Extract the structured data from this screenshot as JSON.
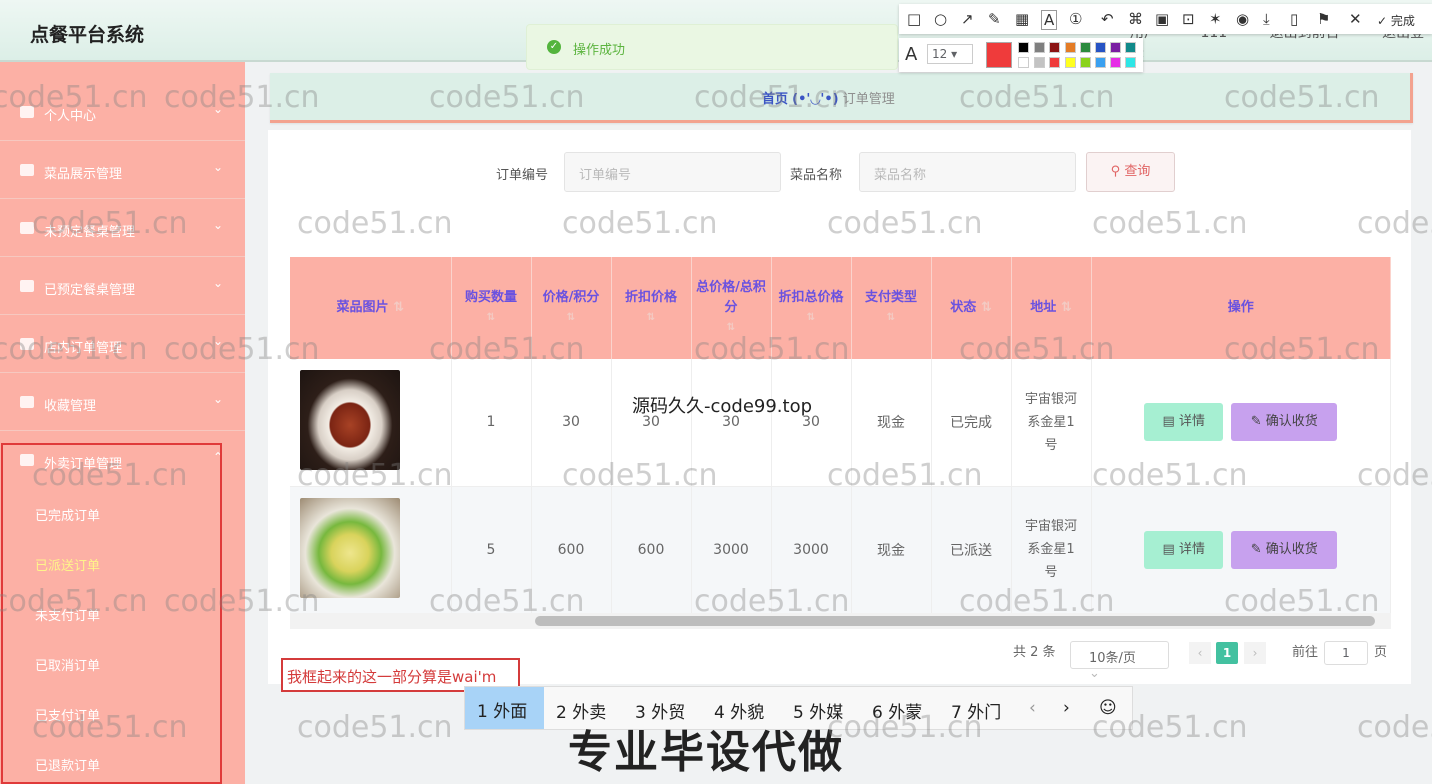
{
  "app": {
    "title": "点餐平台系统"
  },
  "topbar": {
    "links": [
      "用户",
      "111",
      "退出到前台",
      "退出登录"
    ]
  },
  "sidebar": {
    "menu": [
      {
        "label": "个人中心"
      },
      {
        "label": "菜品展示管理"
      },
      {
        "label": "未预定餐桌管理"
      },
      {
        "label": "已预定餐桌管理"
      },
      {
        "label": "店内订单管理"
      },
      {
        "label": "收藏管理"
      },
      {
        "label": "外卖订单管理"
      }
    ],
    "submenu": [
      "已完成订单",
      "已派送订单",
      "未支付订单",
      "已取消订单",
      "已支付订单",
      "已退款订单"
    ]
  },
  "breadcrumb": {
    "home": "首页",
    "face": "(•'◡'•)",
    "current": "订单管理"
  },
  "search": {
    "order_no_label": "订单编号",
    "order_no_placeholder": "订单编号",
    "dish_label": "菜品名称",
    "dish_placeholder": "菜品名称",
    "query_button": "查询"
  },
  "table": {
    "headers": [
      "菜品图片",
      "购买数量",
      "价格/积分",
      "折扣价格",
      "总价格/总积分",
      "折扣总价格",
      "支付类型",
      "状态",
      "地址",
      "操作"
    ],
    "rows": [
      {
        "qty": "1",
        "price": "30",
        "discount": "30",
        "total": "30",
        "discount_total": "30",
        "pay": "现金",
        "status": "已完成",
        "address": "宇宙银河系金星1号"
      },
      {
        "qty": "5",
        "price": "600",
        "discount": "600",
        "total": "3000",
        "discount_total": "3000",
        "pay": "现金",
        "status": "已派送",
        "address": "宇宙银河系金星1号"
      }
    ],
    "detail_button": "详情",
    "confirm_button": "确认收货"
  },
  "pagination": {
    "total": "共 2 条",
    "page_size": "10条/页",
    "current": "1",
    "goto": "前往",
    "goto_value": "1",
    "page_unit": "页"
  },
  "toast": {
    "message": "操作成功"
  },
  "annotation_tool": {
    "done": "完成",
    "font_size": "12"
  },
  "annotation": {
    "text": "我框起来的这一部分算是wai'm"
  },
  "ime": {
    "candidates": [
      "1 外面",
      "2 外卖",
      "3 外贸",
      "4 外貌",
      "5 外媒",
      "6 外蒙",
      "7 外门"
    ],
    "emoji": "☺"
  },
  "overlay": {
    "watermark_site": "源码久久-code99.top",
    "big": "专业毕设代做",
    "wm": "code51.cn"
  }
}
